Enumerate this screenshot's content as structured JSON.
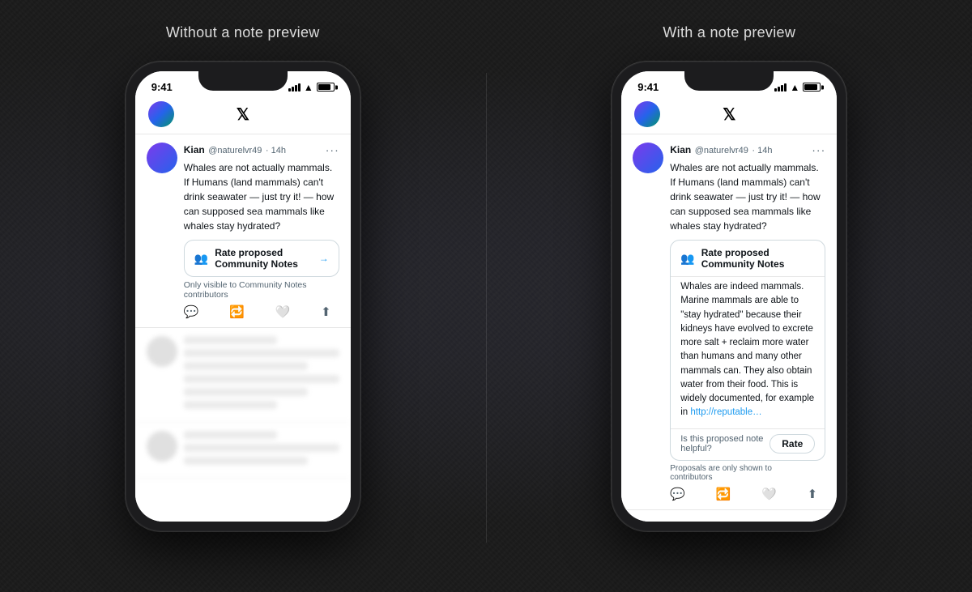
{
  "page": {
    "background_color": "#1a1a1a"
  },
  "panels": [
    {
      "id": "without-preview",
      "title": "Without a note preview",
      "phone": {
        "time": "9:41",
        "nav": {
          "x_logo": "𝕏"
        },
        "tweet": {
          "author": "Kian",
          "handle": "@naturelvr49",
          "timestamp": "14h",
          "text": "Whales are not actually mammals. If Humans (land mammals) can't drink seawater — just try it! — how can supposed sea mammals like whales stay hydrated?",
          "community_notes_label": "Rate proposed Community Notes",
          "community_notes_subtitle": "Only visible to Community Notes contributors"
        }
      }
    },
    {
      "id": "with-preview",
      "title": "With a note preview",
      "phone": {
        "time": "9:41",
        "nav": {
          "x_logo": "𝕏"
        },
        "tweet": {
          "author": "Kian",
          "handle": "@naturelvr49",
          "timestamp": "14h",
          "text": "Whales are not actually mammals. If Humans (land mammals) can't drink seawater — just try it! — how can supposed sea mammals like whales stay hydrated?",
          "community_notes_label": "Rate proposed Community Notes",
          "note_body": "Whales are indeed mammals. Marine mammals are able to \"stay hydrated\" because their kidneys have evolved to excrete more salt + reclaim more water than humans and many other mammals can. They also obtain water from their food. This is widely documented, for example in ",
          "note_link": "http://reputable…",
          "is_helpful_question": "Is this proposed note helpful?",
          "rate_button": "Rate",
          "proposals_subtitle": "Proposals are only shown to contributors"
        }
      }
    }
  ]
}
